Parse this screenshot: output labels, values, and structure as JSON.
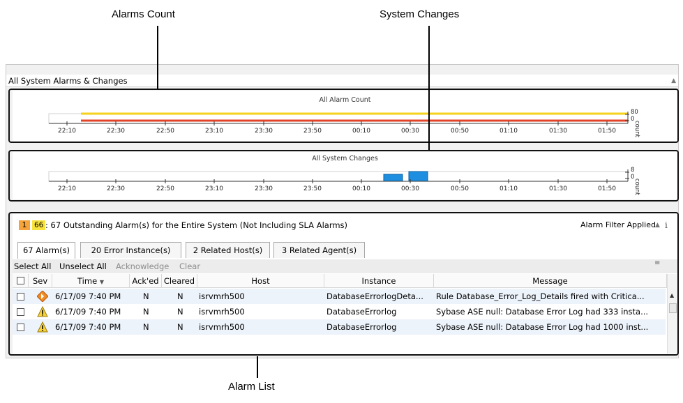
{
  "callouts": {
    "alarms_count": "Alarms Count",
    "system_changes": "System Changes",
    "alarm_list": "Alarm List"
  },
  "panel": {
    "title": "All System Alarms & Changes",
    "collapse_icon": "collapse-up-icon"
  },
  "alarm_count_chart": {
    "title": "All Alarm Count",
    "time_labels": [
      "22:10",
      "22:30",
      "22:50",
      "23:10",
      "23:30",
      "23:50",
      "00:10",
      "00:30",
      "00:50",
      "01:10",
      "01:30",
      "01:50"
    ],
    "y_ticks": [
      "80",
      "0"
    ],
    "y_label": "count",
    "series_colors": {
      "yellow": "#f6d21a",
      "red": "#e2442a"
    }
  },
  "system_changes_chart": {
    "title": "All System Changes",
    "time_labels": [
      "22:10",
      "22:30",
      "22:50",
      "23:10",
      "23:30",
      "23:50",
      "00:10",
      "00:30",
      "00:50",
      "01:10",
      "01:30",
      "01:50"
    ],
    "y_ticks": [
      "8",
      "0"
    ],
    "y_label": "count",
    "bar_color": "#1e8fe0"
  },
  "chart_data": [
    {
      "type": "line",
      "title": "All Alarm Count",
      "x": [
        "22:10",
        "22:30",
        "22:50",
        "23:10",
        "23:30",
        "23:50",
        "00:10",
        "00:30",
        "00:50",
        "01:10",
        "01:30",
        "01:50"
      ],
      "ylabel": "count",
      "ylim": [
        0,
        80
      ]
    },
    {
      "type": "bar",
      "title": "All System Changes",
      "x": [
        "22:10",
        "22:30",
        "22:50",
        "23:10",
        "23:30",
        "23:50",
        "00:10",
        "00:30",
        "00:50",
        "01:10",
        "01:30",
        "01:50"
      ],
      "ylabel": "count",
      "ylim": [
        0,
        8
      ]
    }
  ],
  "summary": {
    "badge_orange": "1",
    "badge_yellow": "66",
    "text": ": 67 Outstanding Alarm(s) for the Entire System (Not Including SLA Alarms)",
    "filter": "Alarm Filter Applied",
    "badge_orange_color": "#f5a33a",
    "badge_yellow_color": "#f7e23e"
  },
  "tabs": [
    "67 Alarm(s)",
    "20 Error Instance(s)",
    "2 Related Host(s)",
    "3 Related Agent(s)"
  ],
  "toolbar": {
    "select_all": "Select All",
    "unselect_all": "Unselect All",
    "acknowledge": "Acknowledge",
    "clear": "Clear"
  },
  "columns": {
    "sev": "Sev",
    "time": "Time",
    "acked": "Ack'ed",
    "cleared": "Cleared",
    "host": "Host",
    "instance": "Instance",
    "message": "Message"
  },
  "rows": [
    {
      "sev_icon": "critical-diamond-icon",
      "time": "6/17/09 7:40 PM",
      "acked": "N",
      "cleared": "N",
      "host": "isrvmrh500",
      "instance": "DatabaseErrorlogDeta...",
      "message": "Rule Database_Error_Log_Details fired with Critica..."
    },
    {
      "sev_icon": "warning-triangle-icon",
      "time": "6/17/09 7:40 PM",
      "acked": "N",
      "cleared": "N",
      "host": "isrvmrh500",
      "instance": "DatabaseErrorlog",
      "message": "Sybase ASE null: Database Error Log had 333 insta..."
    },
    {
      "sev_icon": "warning-triangle-icon",
      "time": "6/17/09 7:40 PM",
      "acked": "N",
      "cleared": "N",
      "host": "isrvmrh500",
      "instance": "DatabaseErrorlog",
      "message": "Sybase ASE null: Database Error Log had 1000 inst..."
    }
  ]
}
